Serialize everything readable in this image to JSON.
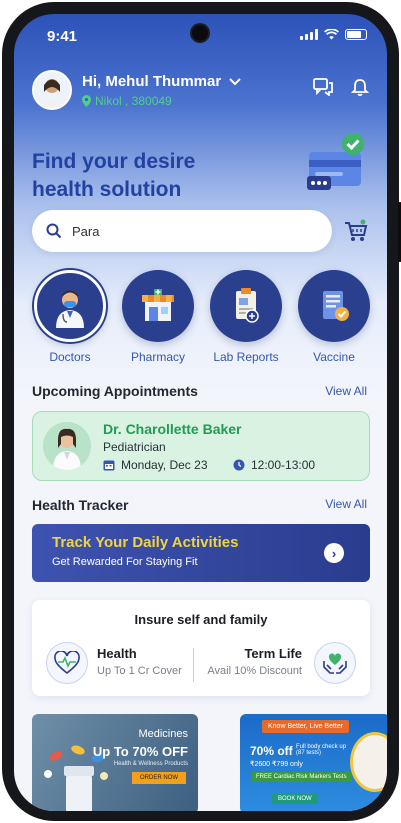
{
  "status_bar": {
    "time": "9:41"
  },
  "header": {
    "greeting": "Hi, Mehul Thummar",
    "location": "Nikol , 380049"
  },
  "hero": {
    "line1": "Find your desire",
    "line2": "health solution"
  },
  "search": {
    "value": "Para"
  },
  "categories": [
    {
      "label": "Doctors",
      "icon": "doctor-icon"
    },
    {
      "label": "Pharmacy",
      "icon": "pharmacy-icon"
    },
    {
      "label": "Lab Reports",
      "icon": "lab-reports-icon"
    },
    {
      "label": "Vaccine",
      "icon": "vaccine-icon"
    }
  ],
  "appointments": {
    "title": "Upcoming Appointments",
    "view_all": "View All",
    "item": {
      "doctor": "Dr. Charollette Baker",
      "specialty": "Pediatrician",
      "date": "Monday, Dec 23",
      "time": "12:00-13:00"
    }
  },
  "tracker": {
    "title": "Health Tracker",
    "view_all": "View All",
    "banner_title": "Track Your Daily Activities",
    "banner_subtitle": "Get Rewarded For Staying Fit"
  },
  "insurance": {
    "title": "Insure self and family",
    "health": {
      "label": "Health",
      "sub": "Up To 1 Cr Cover"
    },
    "term": {
      "label": "Term Life",
      "sub": "Avail 10% Discount"
    }
  },
  "promos": {
    "medicines": {
      "title": "Medicines",
      "offer": "Up To 70% OFF",
      "sub": "Health & Wellness Products",
      "cta": "ORDER NOW"
    },
    "checkup": {
      "tag": "Know Better, Live Better",
      "offer": "70% off",
      "desc": "Full body check up (87 tests)",
      "price": "₹2600 ₹799 only",
      "bonus": "FREE Cardiac Risk Markers Tests",
      "cta": "BOOK NOW"
    }
  },
  "colors": {
    "primary": "#2b3f8f",
    "accent_green": "#229b55",
    "highlight": "#f0d53a"
  }
}
